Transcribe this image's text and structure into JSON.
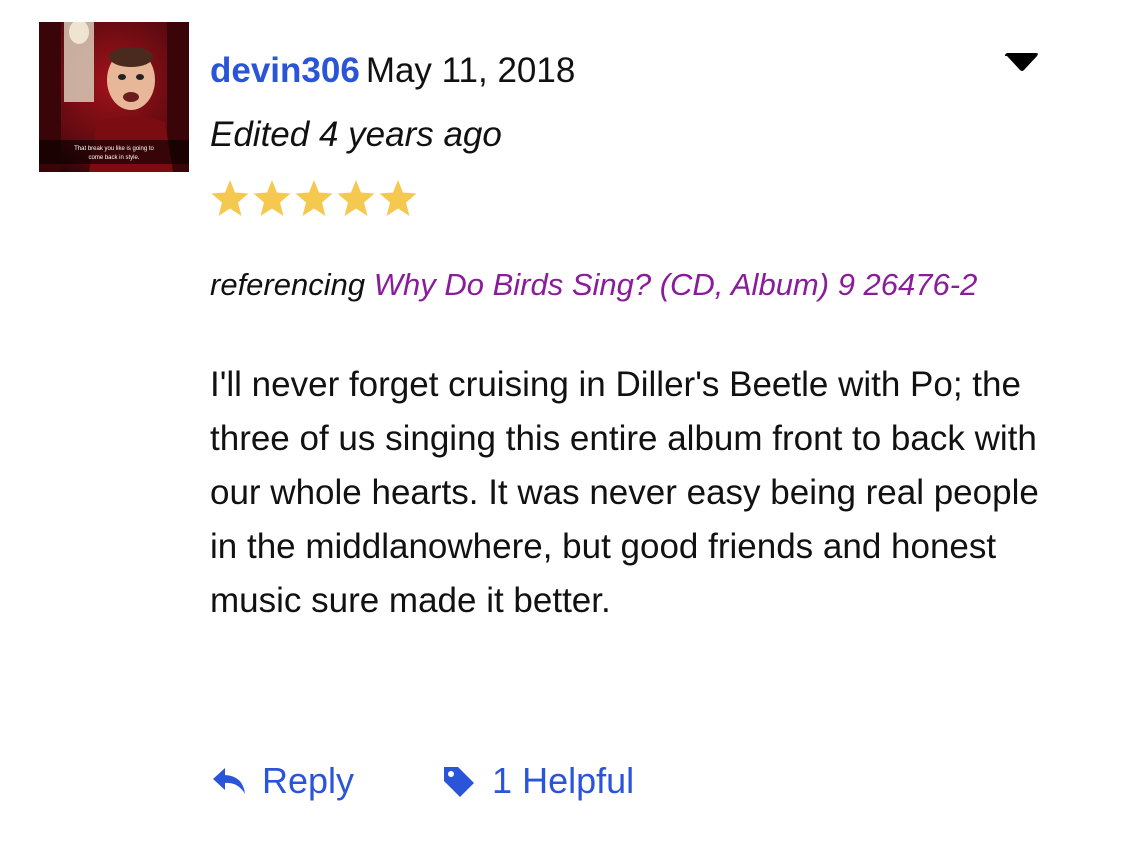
{
  "review": {
    "username": "devin306",
    "date": "May 11, 2018",
    "edited": "Edited 4 years ago",
    "rating": 5,
    "rating_max": 5,
    "referencing_prefix": "referencing",
    "release_link": "Why Do Birds Sing? (CD, Album) 9 26476-2",
    "body": "I'll never forget cruising in Diller's Beetle with Po; the three of us singing this entire album front to back with our whole hearts. It was never easy being real people in the middlanowhere, but good friends and honest music sure made it better.",
    "avatar_caption": "That break you like is going to come back in style."
  },
  "actions": {
    "reply_label": "Reply",
    "helpful_label": "1 Helpful"
  },
  "icons": {
    "menu": "caret-down-icon",
    "reply": "reply-arrow-icon",
    "helpful": "tag-icon",
    "star": "star-icon"
  },
  "colors": {
    "username": "#2a55d8",
    "link": "#8a1c9c",
    "star": "#f5c850",
    "action": "#2a55d8"
  }
}
